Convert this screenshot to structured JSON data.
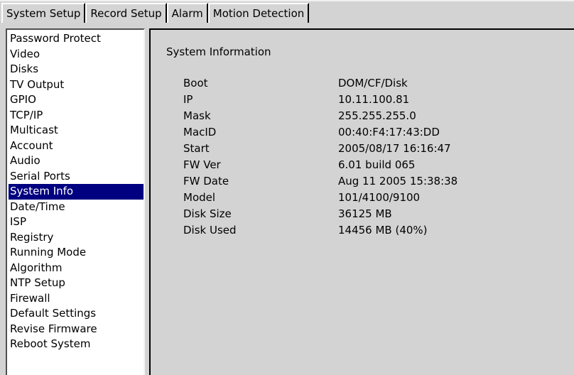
{
  "tabs": [
    {
      "label": "System Setup",
      "active": true
    },
    {
      "label": "Record Setup",
      "active": false
    },
    {
      "label": "Alarm",
      "active": false
    },
    {
      "label": "Motion Detection",
      "active": false
    }
  ],
  "sidebar": {
    "selected": "System Info",
    "items": [
      {
        "label": "Password Protect"
      },
      {
        "label": "Video"
      },
      {
        "label": "Disks"
      },
      {
        "label": "TV Output"
      },
      {
        "label": "GPIO"
      },
      {
        "label": "TCP/IP"
      },
      {
        "label": "Multicast"
      },
      {
        "label": "Account"
      },
      {
        "label": "Audio"
      },
      {
        "label": "Serial Ports"
      },
      {
        "label": "System Info"
      },
      {
        "label": "Date/Time"
      },
      {
        "label": "ISP"
      },
      {
        "label": "Registry"
      },
      {
        "label": "Running Mode"
      },
      {
        "label": "Algorithm"
      },
      {
        "label": "NTP Setup"
      },
      {
        "label": "Firewall"
      },
      {
        "label": "Default Settings"
      },
      {
        "label": "Revise Firmware"
      },
      {
        "label": "Reboot System"
      }
    ]
  },
  "main": {
    "title": "System Information",
    "rows": [
      {
        "label": "Boot",
        "value": "DOM/CF/Disk"
      },
      {
        "label": "IP",
        "value": "10.11.100.81"
      },
      {
        "label": "Mask",
        "value": "255.255.255.0"
      },
      {
        "label": "MacID",
        "value": "00:40:F4:17:43:DD"
      },
      {
        "label": "Start",
        "value": "2005/08/17 16:16:47"
      },
      {
        "label": "FW Ver",
        "value": "6.01 build 065"
      },
      {
        "label": "FW Date",
        "value": "Aug 11 2005 15:38:38"
      },
      {
        "label": "Model",
        "value": "101/4100/9100"
      },
      {
        "label": "Disk Size",
        "value": "36125 MB"
      },
      {
        "label": "Disk Used",
        "value": "14456 MB (40%)"
      }
    ]
  },
  "colors": {
    "background": "#d3d3d3",
    "list_background": "#ffffff",
    "selection": "#000080",
    "selection_text": "#ffffff"
  }
}
